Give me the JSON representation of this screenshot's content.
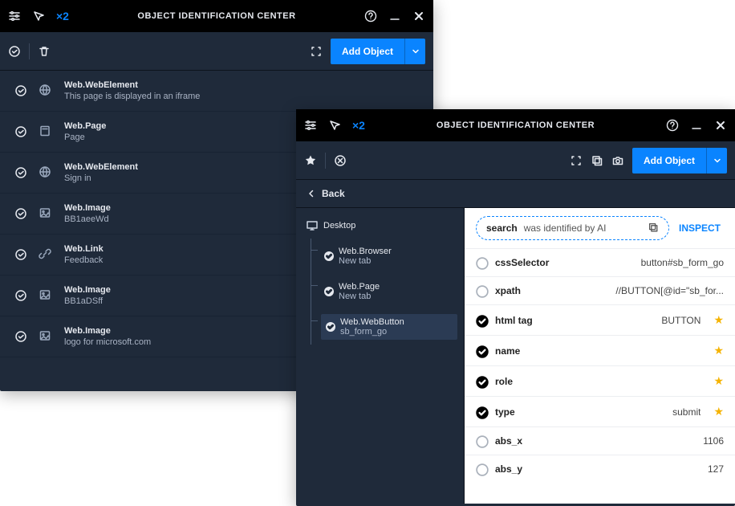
{
  "win1": {
    "title": "OBJECT IDENTIFICATION CENTER",
    "x2": "×2",
    "add_label": "Add Object",
    "objects": [
      {
        "type": "Web.WebElement",
        "desc": "This page is displayed in an iframe",
        "icon": "globe"
      },
      {
        "type": "Web.Page",
        "desc": "Page",
        "icon": "page"
      },
      {
        "type": "Web.WebElement",
        "desc": "Sign in",
        "icon": "globe"
      },
      {
        "type": "Web.Image",
        "desc": "BB1aeeWd",
        "icon": "image"
      },
      {
        "type": "Web.Link",
        "desc": "Feedback",
        "icon": "link"
      },
      {
        "type": "Web.Image",
        "desc": "BB1aDSff",
        "icon": "image"
      },
      {
        "type": "Web.Image",
        "desc": "logo for microsoft.com",
        "icon": "image"
      }
    ]
  },
  "win2": {
    "title": "OBJECT IDENTIFICATION CENTER",
    "x2": "×2",
    "add_label": "Add Object",
    "back_label": "Back",
    "tree": {
      "root": "Desktop",
      "n1_type": "Web.Browser",
      "n1_desc": "New tab",
      "n2_type": "Web.Page",
      "n2_desc": "New tab",
      "n3_type": "Web.WebButton",
      "n3_desc": "sb_form_go"
    },
    "ai": {
      "bold": "search",
      "rest": " was identified by AI",
      "inspect": "INSPECT"
    },
    "props": [
      {
        "on": false,
        "name": "cssSelector",
        "value": "button#sb_form_go",
        "star": false
      },
      {
        "on": false,
        "name": "xpath",
        "value": "//BUTTON[@id=\"sb_for...",
        "star": false
      },
      {
        "on": true,
        "name": "html tag",
        "value": "BUTTON",
        "star": true
      },
      {
        "on": true,
        "name": "name",
        "value": "",
        "star": true
      },
      {
        "on": true,
        "name": "role",
        "value": "",
        "star": true
      },
      {
        "on": true,
        "name": "type",
        "value": "submit",
        "star": true
      },
      {
        "on": false,
        "name": "abs_x",
        "value": "1106",
        "star": false
      },
      {
        "on": false,
        "name": "abs_y",
        "value": "127",
        "star": false
      }
    ]
  }
}
